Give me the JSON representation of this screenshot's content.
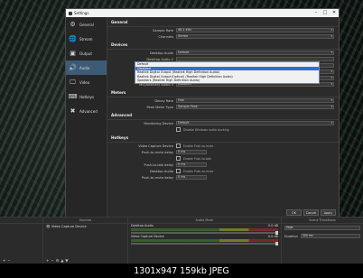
{
  "window": {
    "title": "Settings",
    "controls": [
      "–",
      "□",
      "✕"
    ]
  },
  "sidebar": {
    "items": [
      {
        "label": "General",
        "icon": "gear-icon"
      },
      {
        "label": "Stream",
        "icon": "globe-icon"
      },
      {
        "label": "Output",
        "icon": "output-icon"
      },
      {
        "label": "Audio",
        "icon": "speaker-icon"
      },
      {
        "label": "Video",
        "icon": "monitor-icon"
      },
      {
        "label": "Hotkeys",
        "icon": "keyboard-icon"
      },
      {
        "label": "Advanced",
        "icon": "tools-icon"
      }
    ],
    "active_index": 3
  },
  "general": {
    "heading": "General",
    "sample_rate_label": "Sample Rate",
    "sample_rate_value": "48.1 kHz",
    "channels_label": "Channels",
    "channels_value": "Stereo"
  },
  "devices": {
    "heading": "Devices",
    "desktop_audio_label": "Desktop Audio",
    "desktop_audio_value": "Default",
    "desktop_audio2_label": "Desktop Audio 2",
    "mic_aux_label": "Mic/Auxiliary Audio",
    "mic_aux2_label": "Mic/Auxiliary Audio 2",
    "mic_aux2_value": "Disabled",
    "mic_aux3_label": "Mic/Auxiliary Audio 3",
    "mic_aux3_value": "Disabled",
    "mic_aux4_label": "Mic/Auxiliary Audio 4",
    "mic_aux4_value": "Disabled",
    "dropdown_options": [
      "Default",
      "Disabled",
      "Realtek Digital Output (Realtek High Definition Audio)",
      "Realtek Digital Output(Optical) (Realtek High Definition Audio)",
      "Speakers (Realtek High Definition Audio)"
    ],
    "dropdown_selected_index": 1
  },
  "meters": {
    "heading": "Meters",
    "decay_label": "Decay Rate",
    "decay_value": "Fast",
    "peak_label": "Peak Meter Type",
    "peak_value": "Sample Peak"
  },
  "advanced": {
    "heading": "Advanced",
    "monitoring_label": "Monitoring Device",
    "monitoring_value": "Default",
    "ducking_label": "Disable Windows audio ducking"
  },
  "hotkeys": {
    "heading": "Hotkeys",
    "vcd_label": "Video Capture Device",
    "enable_ptm": "Enable Push-to-mute",
    "ptm_delay": "Push-to-mute delay",
    "enable_ptt": "Enable Push-to-talk",
    "ptt_delay": "Push-to-talk delay",
    "delay_value": "0 ms",
    "desktop_label": "Desktop Audio"
  },
  "footer": {
    "ok": "OK",
    "cancel": "Cancel",
    "apply": "Apply"
  },
  "dock": {
    "sources_header": "Sources",
    "source_item": "Video Capture Device",
    "mixer_header": "Audio Mixer",
    "mixer_ch1": "Desktop Audio",
    "mixer_ch1_db": "0.0 dB",
    "mixer_ch2": "Video Capture Device",
    "mixer_ch2_db": "0.0 dB",
    "transitions_header": "Scene Transitions",
    "transition_value": "Fade",
    "duration_label": "Duration",
    "duration_value": "300 ms"
  },
  "caption": "1301x947  159kb  JPEG"
}
